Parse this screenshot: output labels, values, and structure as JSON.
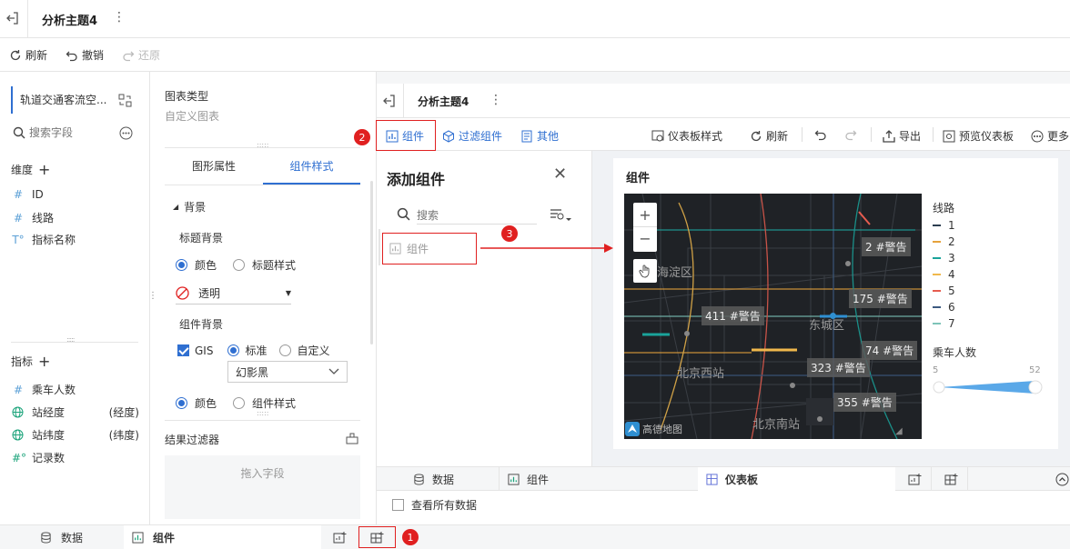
{
  "topbar": {
    "title": "分析主题4"
  },
  "toolbar": {
    "refresh": "刷新",
    "undo": "撤销",
    "redo": "还原"
  },
  "left": {
    "dataset": "轨道交通客流空...",
    "search_placeholder": "搜索字段",
    "dimension_header": "维度",
    "dimensions": [
      {
        "label": "ID",
        "type": "#"
      },
      {
        "label": "线路",
        "type": "#"
      },
      {
        "label": "指标名称",
        "type": "T°"
      }
    ],
    "measure_header": "指标",
    "measures": [
      {
        "label": "乘车人数",
        "type": "#",
        "extra": ""
      },
      {
        "label": "站经度",
        "type": "globe",
        "extra": "(经度)"
      },
      {
        "label": "站纬度",
        "type": "globe",
        "extra": "(纬度)"
      },
      {
        "label": "记录数",
        "type": "#°",
        "extra": ""
      }
    ]
  },
  "mid": {
    "chart_type_label": "图表类型",
    "chart_type_value": "自定义图表",
    "tab_props": "图形属性",
    "tab_style": "组件样式",
    "section_bg": "背景",
    "title_bg": "标题背景",
    "opt_color": "颜色",
    "opt_title_style": "标题样式",
    "transparent": "透明",
    "comp_bg": "组件背景",
    "gis": "GIS",
    "standard": "标准",
    "custom": "自定义",
    "theme": "幻影黑",
    "opt_color2": "颜色",
    "opt_comp_style": "组件样式",
    "result_filter": "结果过滤器",
    "drop_field": "拖入字段"
  },
  "inner": {
    "title": "分析主题4",
    "tools": {
      "component": "组件",
      "filter": "过滤组件",
      "other": "其他",
      "dashboard_style": "仪表板样式",
      "refresh": "刷新",
      "export": "导出",
      "preview": "预览仪表板",
      "more": "更多"
    },
    "dialog": {
      "title": "添加组件",
      "search_placeholder": "搜索",
      "item": "组件"
    },
    "card_title": "组件",
    "map": {
      "labels": [
        "海淀区",
        "东城区",
        "北京西站",
        "北京南站"
      ],
      "tags": [
        "2 #警告",
        "175 #警告",
        "411 #警告",
        "74 #警告",
        "323 #警告",
        "355 #警告"
      ],
      "logo": "高德地图"
    },
    "legend": {
      "title": "线路",
      "items": [
        {
          "label": "1",
          "color": "#2c3e50"
        },
        {
          "label": "2",
          "color": "#e6a23c"
        },
        {
          "label": "3",
          "color": "#1aa39a"
        },
        {
          "label": "4",
          "color": "#f0b84c"
        },
        {
          "label": "5",
          "color": "#e65c4f"
        },
        {
          "label": "6",
          "color": "#3d5a80"
        },
        {
          "label": "7",
          "color": "#7ec4b8"
        }
      ],
      "size_title": "乘车人数",
      "size_min": "5",
      "size_max": "52"
    },
    "bottom_tabs": {
      "data": "数据",
      "component": "组件",
      "dashboard": "仪表板"
    },
    "view_all": "查看所有数据"
  },
  "outer_bottom": {
    "data": "数据",
    "component": "组件"
  },
  "badges": [
    "1",
    "2",
    "3"
  ]
}
